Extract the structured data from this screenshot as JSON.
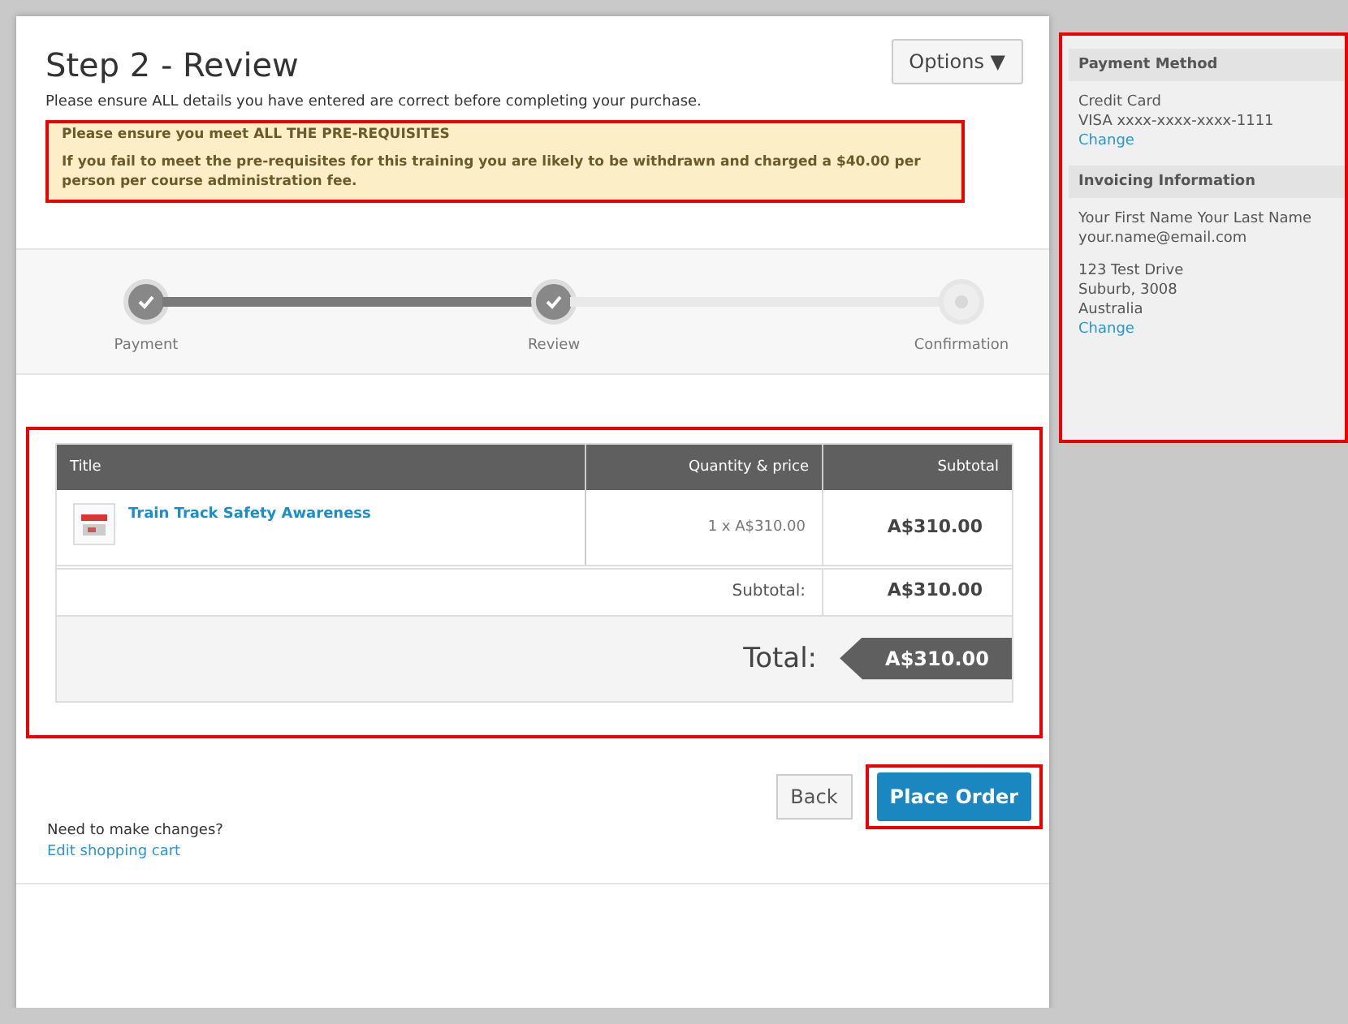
{
  "header": {
    "title": "Step 2 - Review",
    "options_button": "Options ▼",
    "subtitle": "Please ensure ALL details you have entered are correct before completing your purchase."
  },
  "notice": {
    "heading": "Please ensure you meet ALL THE PRE-REQUISITES",
    "body": "If you fail to meet the pre-requisites for this training you are likely to be withdrawn and charged a $40.00 per person per course administration fee."
  },
  "steps": [
    {
      "label": "Payment",
      "completed": true
    },
    {
      "label": "Review",
      "completed": true
    },
    {
      "label": "Confirmation",
      "completed": false
    }
  ],
  "table": {
    "columns": [
      "Title",
      "Quantity & price",
      "Subtotal"
    ],
    "rows": [
      {
        "title": "Train Track Safety Awareness",
        "quantity_price": "1 x A$310.00",
        "subtotal": "A$310.00"
      }
    ],
    "subtotal_label": "Subtotal:",
    "subtotal_value": "A$310.00",
    "total_label": "Total:",
    "total_value": "A$310.00"
  },
  "actions": {
    "back": "Back",
    "place_order": "Place Order"
  },
  "footer": {
    "question": "Need to make changes?",
    "link": "Edit shopping cart"
  },
  "sidebar": {
    "payment": {
      "heading": "Payment Method",
      "lines": [
        "Credit Card",
        "VISA xxxx-xxxx-xxxx-1111"
      ],
      "link": "Change"
    },
    "invoicing": {
      "heading": "Invoicing Information",
      "lines": [
        "Your First Name Your Last Name",
        "your.name@email.com"
      ],
      "address": [
        "123 Test Drive",
        "Suburb, 3008",
        "Australia"
      ],
      "link": "Change"
    }
  }
}
